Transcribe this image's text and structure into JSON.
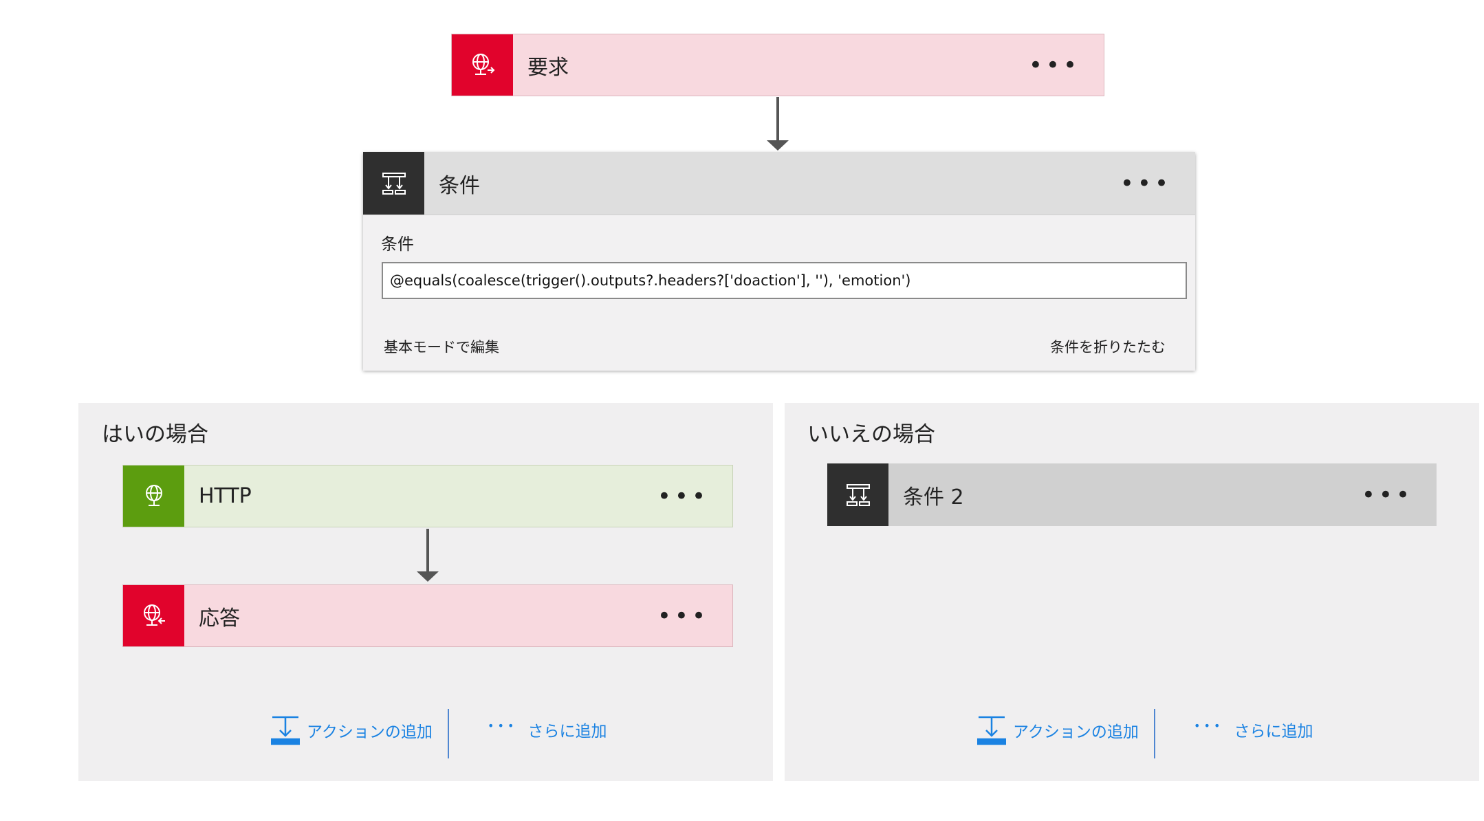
{
  "trigger": {
    "title": "要求",
    "icon": "globe-outgoing-icon",
    "menu": "•••"
  },
  "condition": {
    "title": "条件",
    "icon": "condition-icon",
    "menu": "•••",
    "field_label": "条件",
    "expression": "@equals(coalesce(trigger().outputs?.headers?['doaction'], ''),  'emotion')",
    "edit_basic": "基本モードで編集",
    "collapse": "条件を折りたたむ"
  },
  "yes_branch": {
    "title": "はいの場合",
    "actions": [
      {
        "title": "HTTP",
        "icon": "globe-icon",
        "menu": "•••"
      },
      {
        "title": "応答",
        "icon": "globe-response-icon",
        "menu": "•••"
      }
    ],
    "add_action": "アクションの追加",
    "add_more": "さらに追加",
    "more_dots": "• • •"
  },
  "no_branch": {
    "title": "いいえの場合",
    "actions": [
      {
        "title": "条件 2",
        "icon": "condition-icon",
        "menu": "•••"
      }
    ],
    "add_action": "アクションの追加",
    "add_more": "さらに追加",
    "more_dots": "• • •"
  },
  "colors": {
    "request_accent": "#e1032c",
    "request_bg": "#f8d9df",
    "http_accent": "#5c9d0f",
    "http_bg": "#e6eedb",
    "condition_dark": "#2f2f2f",
    "link_blue": "#1a82e2"
  }
}
